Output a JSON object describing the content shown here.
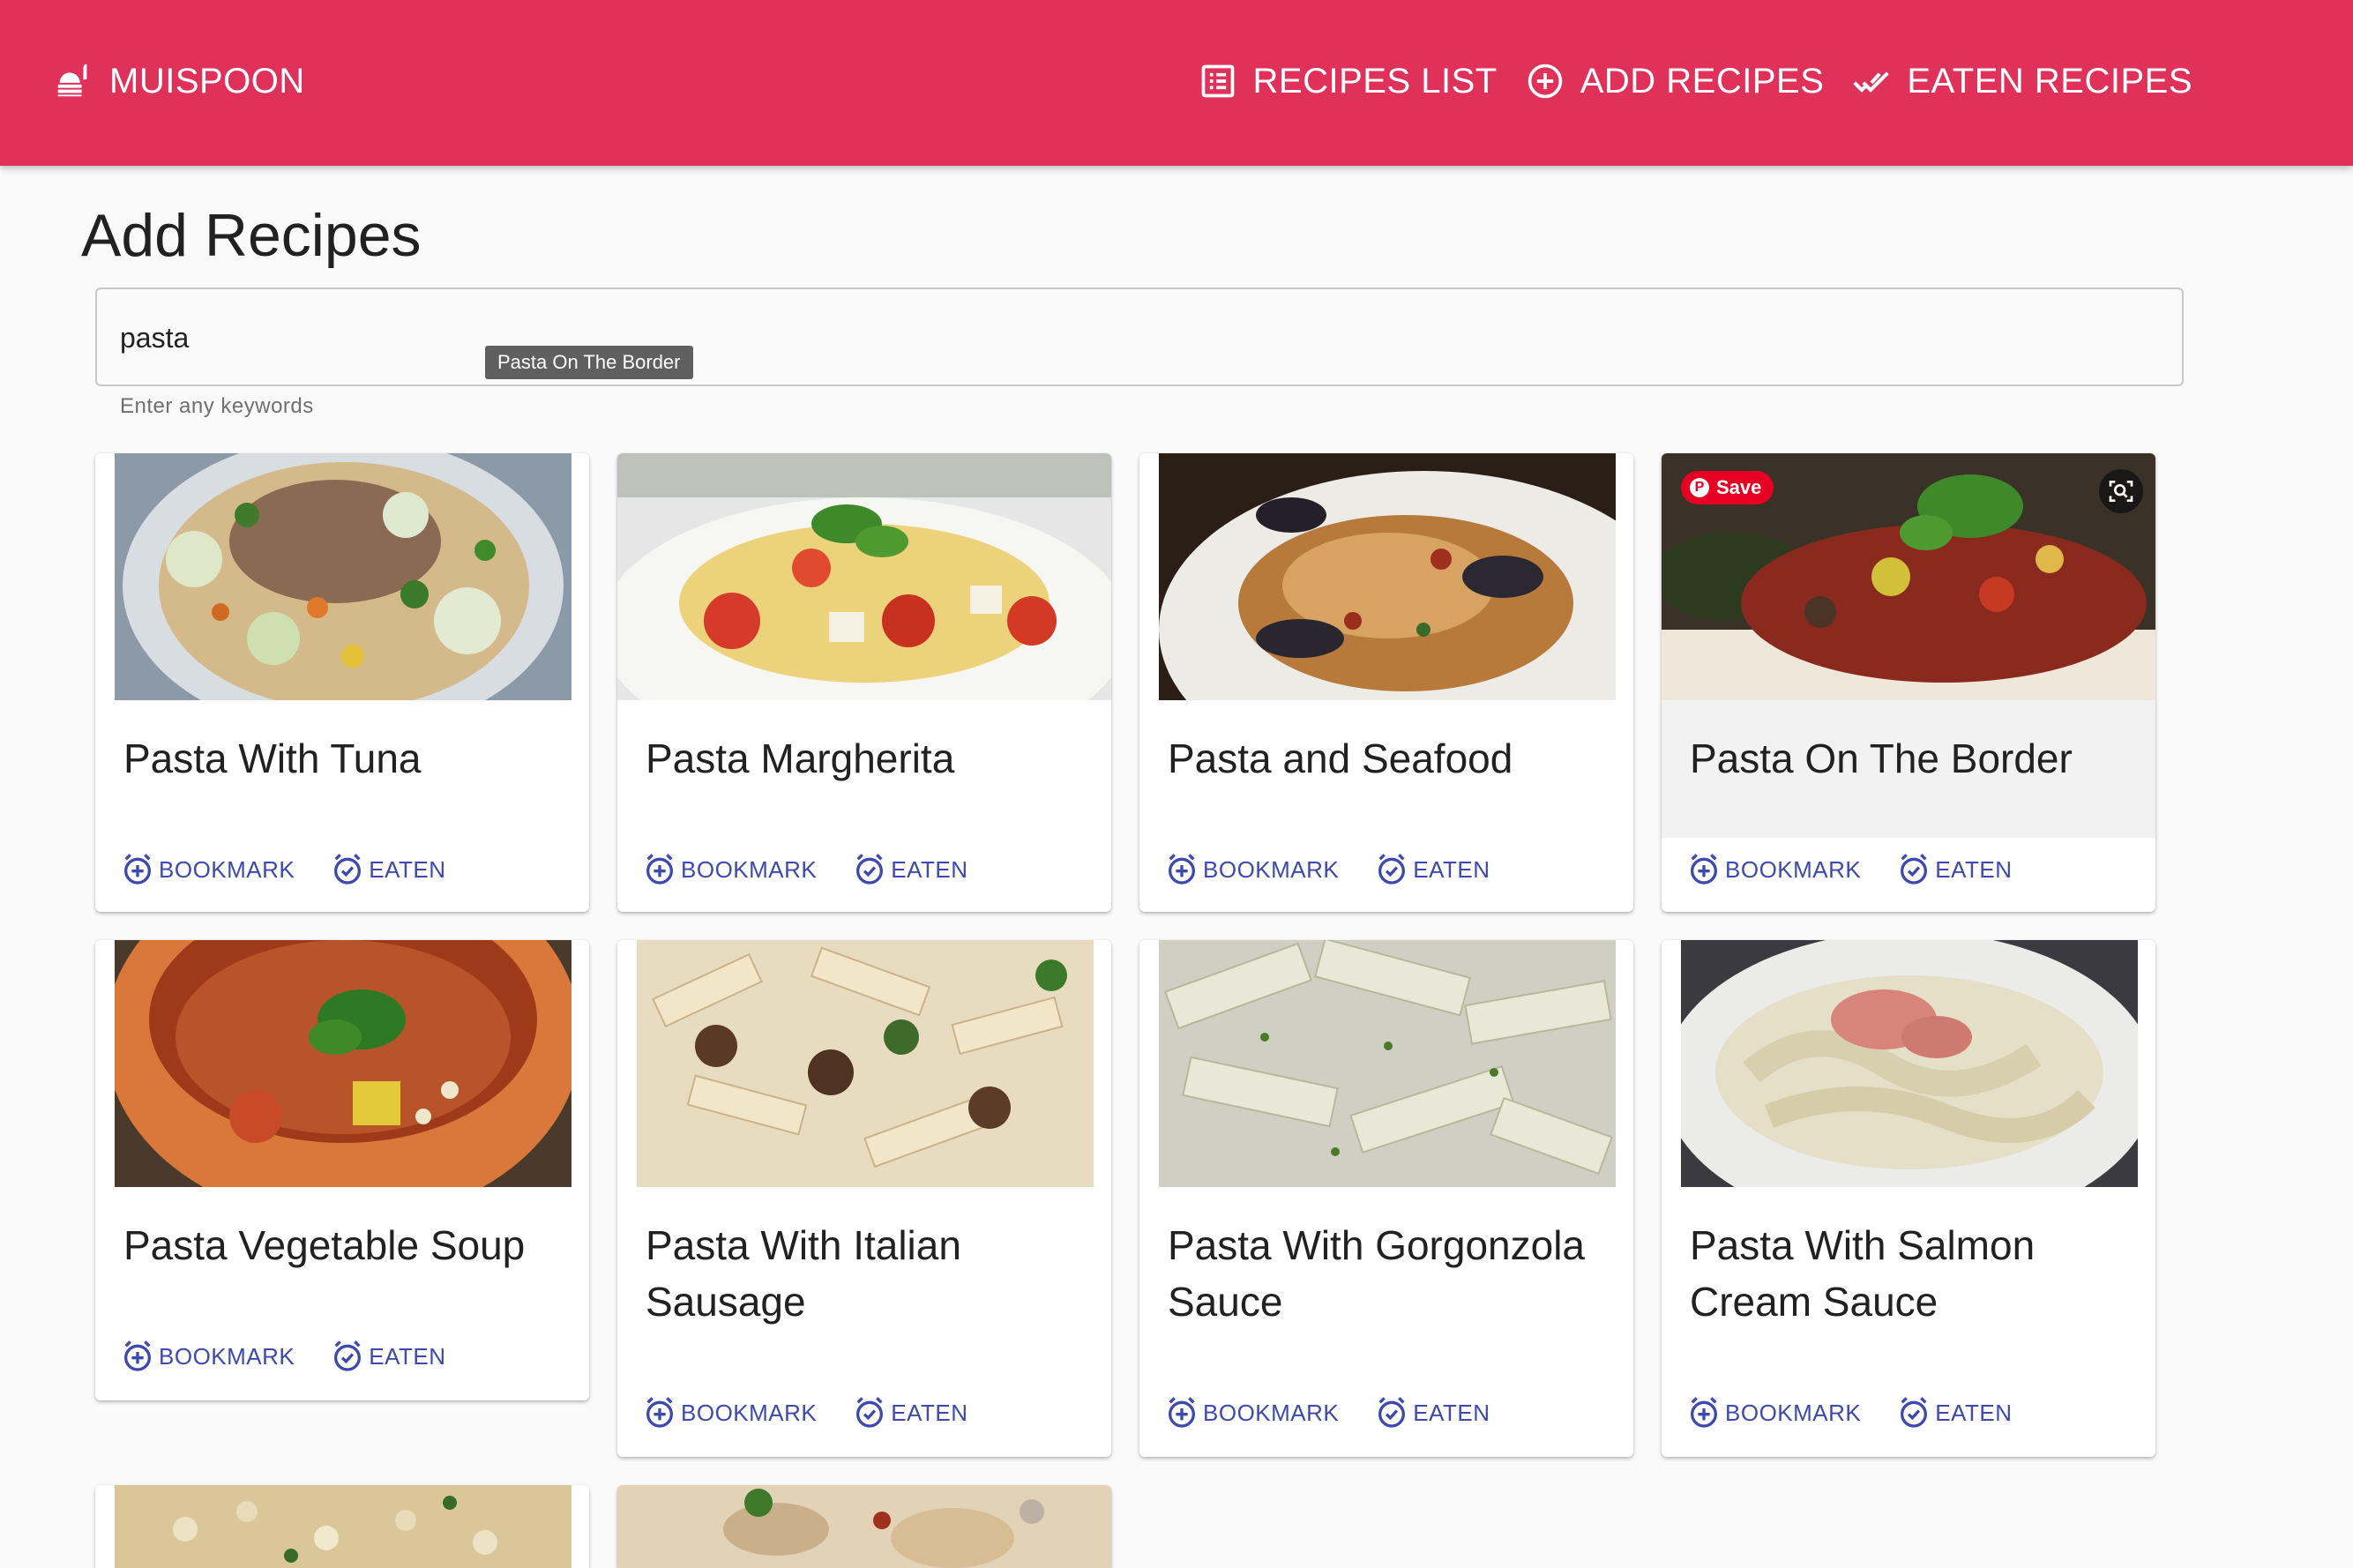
{
  "app": {
    "brand": "MUISPOON",
    "nav": [
      {
        "label": "RECIPES LIST",
        "icon": "list-icon"
      },
      {
        "label": "ADD RECIPES",
        "icon": "add-circle-icon"
      },
      {
        "label": "EATEN RECIPES",
        "icon": "done-all-icon"
      }
    ],
    "accent": "#e0315b",
    "action_color": "#3c4ab0"
  },
  "page": {
    "title": "Add Recipes",
    "search": {
      "value": "pasta",
      "helper": "Enter any keywords",
      "tooltip": "Pasta On The Border"
    }
  },
  "actions": {
    "bookmark": "BOOKMARK",
    "eaten": "EATEN"
  },
  "recipes": [
    {
      "title": "Pasta With Tuna"
    },
    {
      "title": "Pasta Margherita"
    },
    {
      "title": "Pasta and Seafood"
    },
    {
      "title": "Pasta On The Border",
      "save_label": "Save"
    },
    {
      "title": "Pasta Vegetable Soup"
    },
    {
      "title": "Pasta With Italian Sausage"
    },
    {
      "title": "Pasta With Gorgonzola Sauce"
    },
    {
      "title": "Pasta With Salmon Cream Sauce"
    }
  ]
}
